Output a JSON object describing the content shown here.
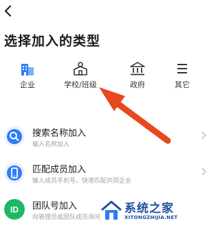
{
  "header": {
    "back_icon": "back-arrow-icon",
    "title": "选择加入的类型"
  },
  "types": [
    {
      "label": "企业",
      "icon": "building-icon"
    },
    {
      "label": "学校/班级",
      "icon": "school-icon"
    },
    {
      "label": "政府",
      "icon": "government-icon"
    },
    {
      "label": "其它",
      "icon": "menu-icon"
    }
  ],
  "options": [
    {
      "title": "搜索名称加入",
      "subtitle": "输入名称加入",
      "icon": "search-icon",
      "color": "#2f7cf6"
    },
    {
      "title": "匹配成员加入",
      "subtitle": "输入成员手机号，快速匹配共同企业",
      "icon": "phone-icon",
      "color": "#2f7cf6"
    },
    {
      "title": "团队号加入",
      "subtitle": "向管理员或团队成员询问",
      "icon": "id-badge-icon",
      "color": "#1db866"
    }
  ],
  "colors": {
    "accent_blue": "#2f7cf6",
    "accent_green": "#1db866",
    "arrow_red": "#e8471f",
    "watermark_blue": "#1d4fa0"
  },
  "watermark": {
    "text": "系统之家",
    "url": "XITONGZHIJIA.NET"
  }
}
